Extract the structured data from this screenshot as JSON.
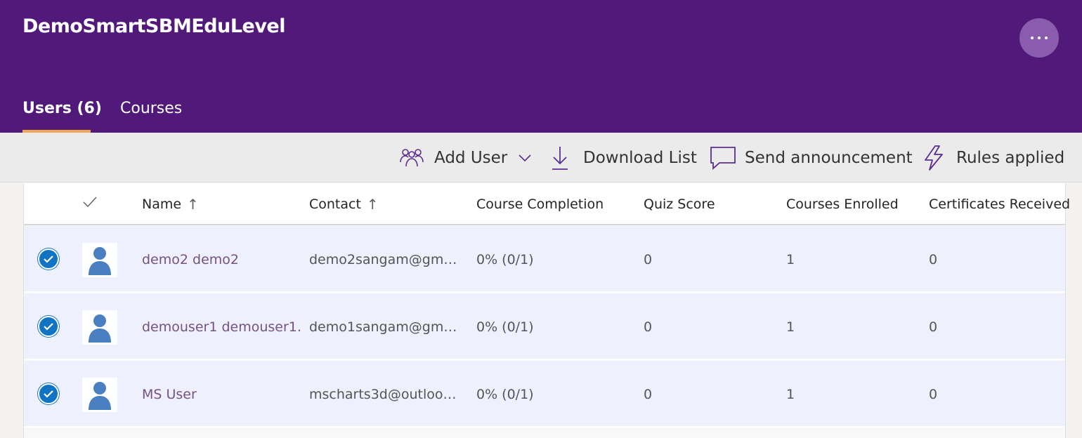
{
  "app": {
    "title": "DemoSmartSBMEduLevel"
  },
  "tabs": [
    {
      "label": "Users (6)",
      "active": true
    },
    {
      "label": "Courses",
      "active": false
    }
  ],
  "toolbar": {
    "add_user": "Add User",
    "download_list": "Download List",
    "send_announcement": "Send announcement",
    "rules_applied": "Rules applied"
  },
  "table": {
    "columns": {
      "name": "Name",
      "contact": "Contact",
      "course_completion": "Course Completion",
      "quiz_score": "Quiz Score",
      "courses_enrolled": "Courses Enrolled",
      "certificates_received": "Certificates Received"
    },
    "rows": [
      {
        "name": "demo2 demo2",
        "contact": "demo2sangam@gm…",
        "completion": "0% (0/1)",
        "quiz": "0",
        "enrolled": "1",
        "certs": "0",
        "selected": true
      },
      {
        "name": "demouser1 demouser1…",
        "contact": "demo1sangam@gm…",
        "completion": "0% (0/1)",
        "quiz": "0",
        "enrolled": "1",
        "certs": "0",
        "selected": true
      },
      {
        "name": "MS User",
        "contact": "mscharts3d@outloo…",
        "completion": "0% (0/1)",
        "quiz": "0",
        "enrolled": "1",
        "certs": "0",
        "selected": true
      }
    ]
  },
  "colors": {
    "header_bg": "#511a7a",
    "tab_underline": "#f0a850",
    "accent_icon": "#5c2d91",
    "row_selected_bg": "#eef0fd",
    "check_blue": "#1173c4",
    "avatar_blue": "#4a7fc1"
  },
  "icons": [
    "more-icon",
    "add-user-icon",
    "chevron-down-icon",
    "download-icon",
    "announcement-icon",
    "rules-icon",
    "checkmark-icon",
    "sort-arrow-icon",
    "avatar-icon"
  ]
}
